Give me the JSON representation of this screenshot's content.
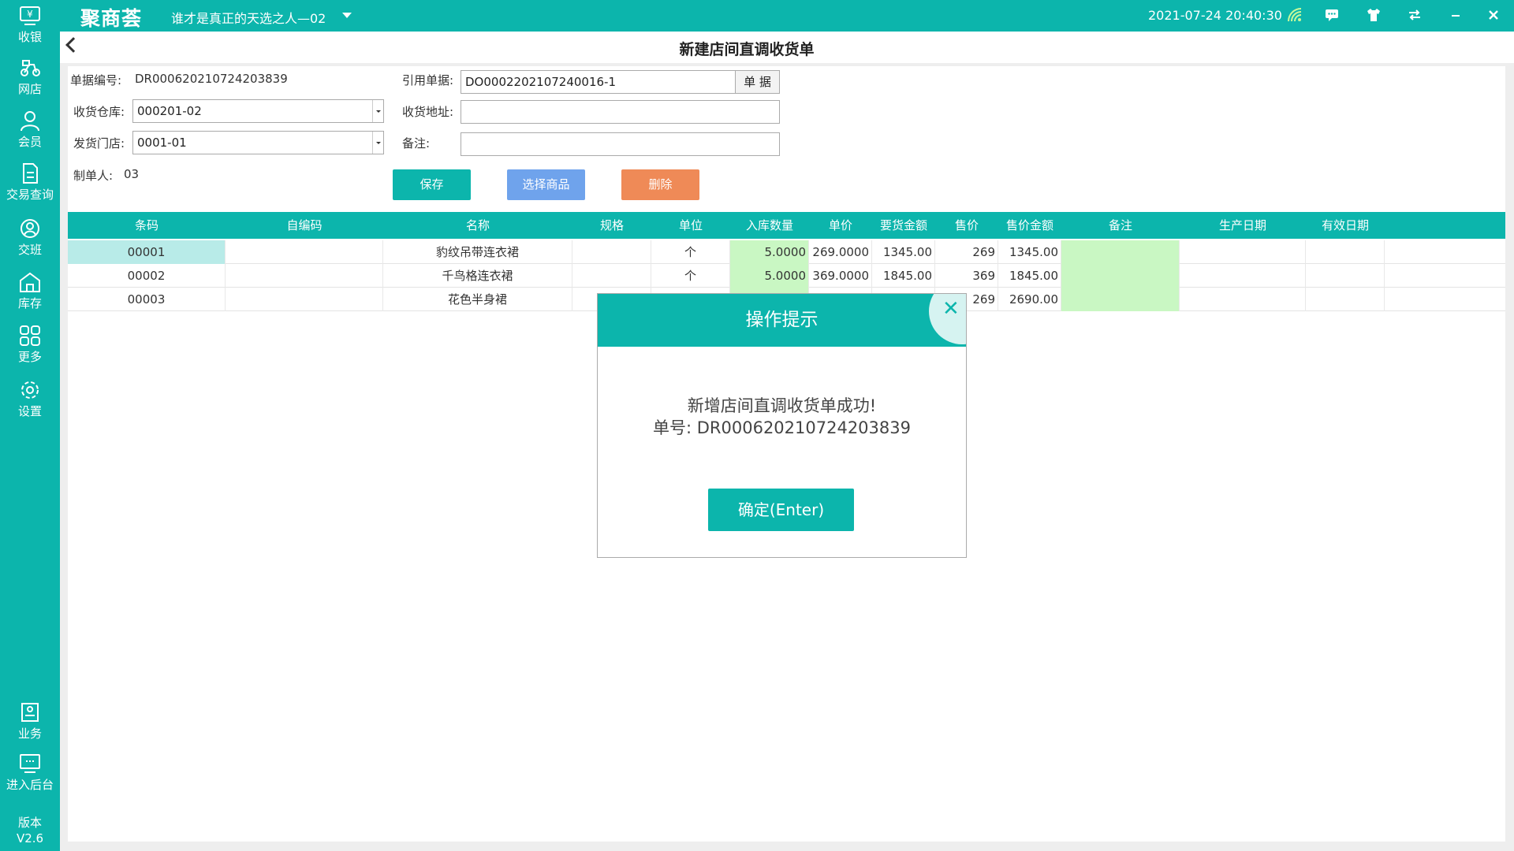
{
  "app": {
    "logo_text": "聚商荟",
    "store_name": "谁才是真正的天选之人—02",
    "datetime": "2021-07-24 20:40:30"
  },
  "titlebar_icons": [
    "wifi-icon",
    "message-icon",
    "shirt-icon",
    "switch-icon",
    "minimize-icon",
    "close-icon"
  ],
  "sidebar": {
    "items": [
      {
        "label": "收银",
        "icon": "cashier-icon"
      },
      {
        "label": "网店",
        "icon": "delivery-icon"
      },
      {
        "label": "会员",
        "icon": "member-icon"
      },
      {
        "label": "交易查询",
        "icon": "document-icon"
      },
      {
        "label": "交班",
        "icon": "shift-icon"
      },
      {
        "label": "库存",
        "icon": "warehouse-icon"
      },
      {
        "label": "更多",
        "icon": "grid-icon"
      },
      {
        "label": "设置",
        "icon": "gear-icon"
      },
      {
        "label": "业务",
        "icon": "business-icon"
      },
      {
        "label": "进入后台",
        "icon": "monitor-icon"
      }
    ],
    "version_label": "版本",
    "version": "V2.6"
  },
  "page": {
    "title": "新建店间直调收货单"
  },
  "form": {
    "doc_no_label": "单据编号:",
    "doc_no": "DR000620210724203839",
    "ref_doc_label": "引用单据:",
    "ref_doc": "DO0002202107240016-1",
    "ref_doc_button": "单  据",
    "warehouse_label": "收货仓库:",
    "warehouse": "000201-02",
    "address_label": "收货地址:",
    "address": "",
    "store_label": "发货门店:",
    "store": "0001-01",
    "note_label": "备注:",
    "note": "",
    "maker_label": "制单人:",
    "maker": "03"
  },
  "buttons": {
    "save": "保存",
    "choose": "选择商品",
    "delete": "删除"
  },
  "colors": {
    "primary": "#0cb5ac",
    "choose_button": "#6fa3ec",
    "delete_button": "#ef8a57",
    "editable_cell": "#c9f7c3"
  },
  "table": {
    "columns": [
      "条码",
      "自编码",
      "名称",
      "规格",
      "单位",
      "入库数量",
      "单价",
      "要货金额",
      "售价",
      "售价金额",
      "备注",
      "生产日期",
      "有效日期"
    ],
    "rows": [
      [
        "00001",
        "",
        "豹纹吊带连衣裙",
        "",
        "个",
        "5.0000",
        "269.0000",
        "1345.00",
        "269",
        "1345.00",
        "",
        "",
        ""
      ],
      [
        "00002",
        "",
        "千鸟格连衣裙",
        "",
        "个",
        "5.0000",
        "369.0000",
        "1845.00",
        "369",
        "1845.00",
        "",
        "",
        ""
      ],
      [
        "00003",
        "",
        "花色半身裙",
        "",
        "",
        "",
        "",
        "",
        "269",
        "2690.00",
        "",
        "",
        ""
      ]
    ]
  },
  "modal": {
    "title": "操作提示",
    "message_line1": "新增店间直调收货单成功!",
    "message_line2": "单号:  DR000620210724203839",
    "ok_button": "确定(Enter)"
  }
}
